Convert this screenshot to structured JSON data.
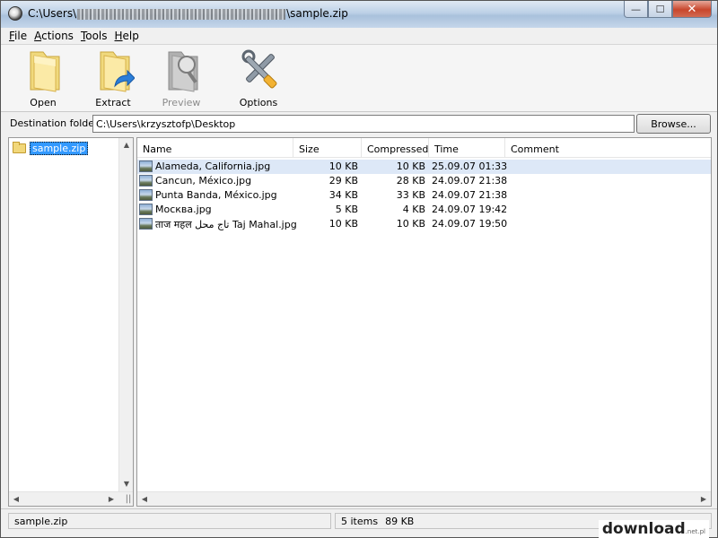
{
  "window": {
    "title_prefix": "C:\\Users\\",
    "title_suffix": "\\sample.zip",
    "minimize_glyph": "—",
    "maximize_glyph": "☐",
    "close_glyph": "✕"
  },
  "menu": [
    "File",
    "Actions",
    "Tools",
    "Help"
  ],
  "toolbar": {
    "open": "Open",
    "extract": "Extract",
    "preview": "Preview",
    "options": "Options"
  },
  "destination": {
    "label": "Destination folder:",
    "value": "C:\\Users\\krzysztofp\\Desktop",
    "browse": "Browse..."
  },
  "tree": {
    "root": "sample.zip"
  },
  "columns": [
    "Name",
    "Size",
    "Compressed",
    "Time",
    "Comment"
  ],
  "files": [
    {
      "name": "Alameda, California.jpg",
      "size": "10 KB",
      "compressed": "10 KB",
      "time": "25.09.07 01:33",
      "comment": ""
    },
    {
      "name": "Cancun, México.jpg",
      "size": "29 KB",
      "compressed": "28 KB",
      "time": "24.09.07 21:38",
      "comment": ""
    },
    {
      "name": "Punta Banda, México.jpg",
      "size": "34 KB",
      "compressed": "33 KB",
      "time": "24.09.07 21:38",
      "comment": ""
    },
    {
      "name": "Москва.jpg",
      "size": "5 KB",
      "compressed": "4 KB",
      "time": "24.09.07 19:42",
      "comment": ""
    },
    {
      "name": "ताज महल تاج محل Taj Mahal.jpg",
      "size": "10 KB",
      "compressed": "10 KB",
      "time": "24.09.07 19:50",
      "comment": ""
    }
  ],
  "status": {
    "archive": "sample.zip",
    "items": "5 items",
    "total_size": "89 KB"
  },
  "watermark": {
    "text": "download",
    "suffix": ".net.pl"
  }
}
